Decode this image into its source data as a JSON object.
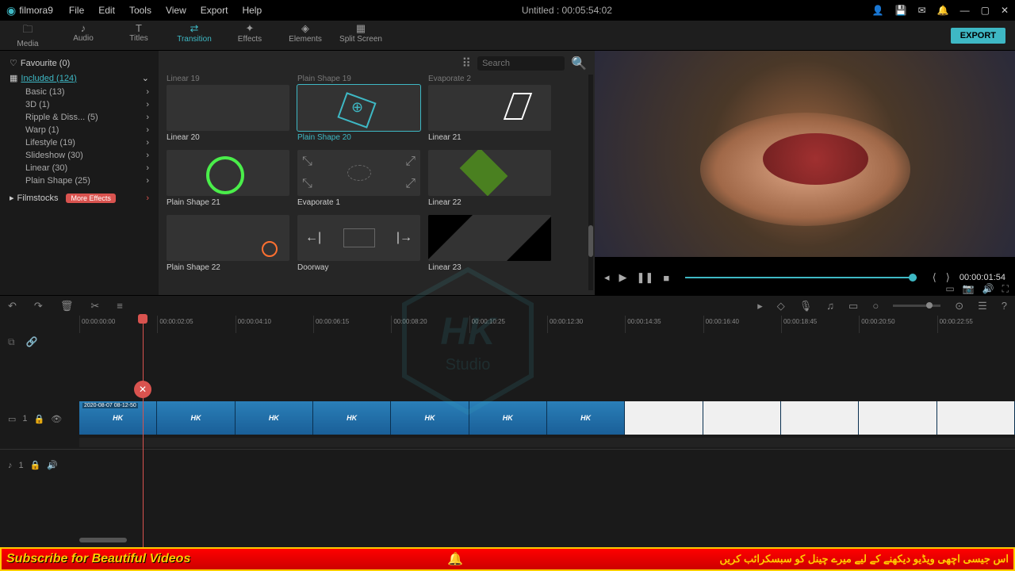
{
  "app": {
    "name": "filmora9",
    "title": "Untitled : 00:05:54:02"
  },
  "menu": [
    "File",
    "Edit",
    "Tools",
    "View",
    "Export",
    "Help"
  ],
  "tabs": [
    {
      "label": "Media",
      "icon": "🗀"
    },
    {
      "label": "Audio",
      "icon": "♪"
    },
    {
      "label": "Titles",
      "icon": "T"
    },
    {
      "label": "Transition",
      "icon": "⇄",
      "active": true
    },
    {
      "label": "Effects",
      "icon": "✦"
    },
    {
      "label": "Elements",
      "icon": "◈"
    },
    {
      "label": "Split Screen",
      "icon": "▦"
    }
  ],
  "export_label": "EXPORT",
  "sidebar": {
    "favourite": "Favourite (0)",
    "included": "Included (124)",
    "subs": [
      "Basic (13)",
      "3D (1)",
      "Ripple & Diss... (5)",
      "Warp (1)",
      "Lifestyle (19)",
      "Slideshow (30)",
      "Linear (30)",
      "Plain Shape (25)"
    ],
    "filmstocks": "Filmstocks",
    "more_effects": "More Effects"
  },
  "search_placeholder": "Search",
  "thumbs_top": [
    "Linear 19",
    "Plain Shape 19",
    "Evaporate 2"
  ],
  "thumbs": [
    {
      "label": "Linear 20",
      "cls": "t-pink"
    },
    {
      "label": "Plain Shape 20",
      "cls": "t-hex",
      "selected": true
    },
    {
      "label": "Linear 21",
      "cls": "t-l21"
    },
    {
      "label": "Plain Shape 21",
      "cls": "t-circ"
    },
    {
      "label": "Evaporate 1",
      "cls": "t-evap"
    },
    {
      "label": "Linear 22",
      "cls": "t-l22"
    },
    {
      "label": "Plain Shape 22",
      "cls": "t-ps22"
    },
    {
      "label": "Doorway",
      "cls": "t-door"
    },
    {
      "label": "Linear 23",
      "cls": "t-l23"
    }
  ],
  "preview": {
    "timecode": "00:00:01:54"
  },
  "ruler": [
    "00:00:00:00",
    "00:00:02:05",
    "00:00:04:10",
    "00:00:06:15",
    "00:00:08:20",
    "00:00:10:25",
    "00:00:12:30",
    "00:00:14:35",
    "00:00:16:40",
    "00:00:18:45",
    "00:00:20:50",
    "00:00:22:55"
  ],
  "clip_label": "2020-08-07 08-12-50",
  "track_num": "1",
  "banner": {
    "sub": "Subscribe for Beautiful Videos",
    "urdu": "اس جیسی اچھی ویڈیو دیکھنے کے لیے میرے چینل کو سبسکرائب کریں"
  }
}
